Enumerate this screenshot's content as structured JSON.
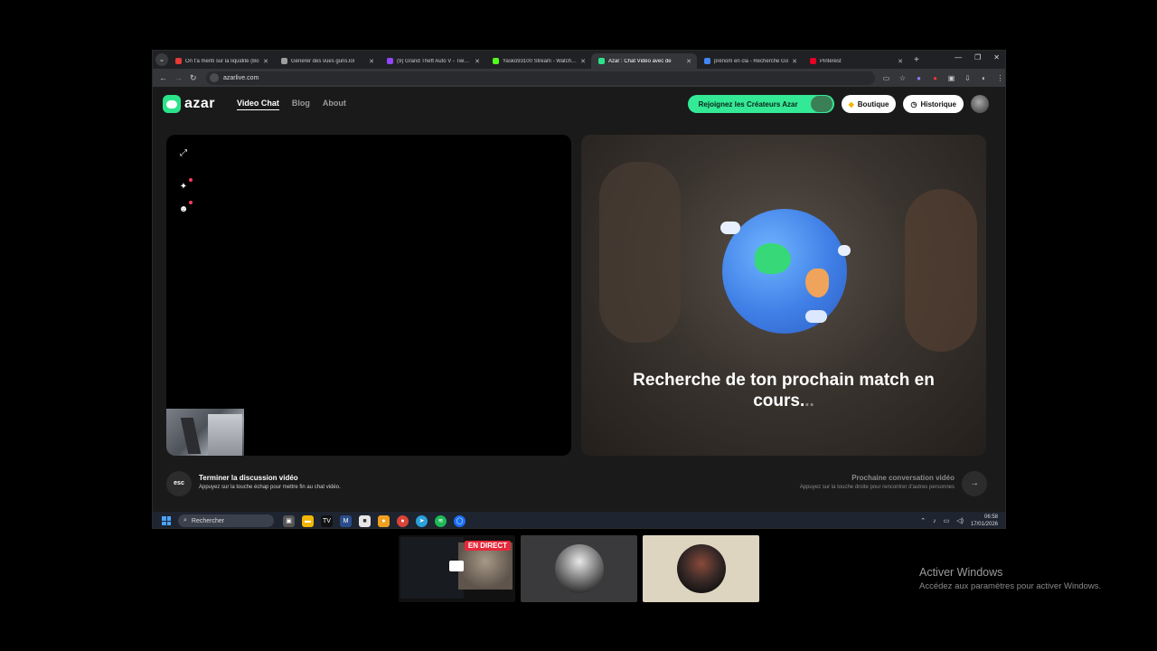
{
  "browser": {
    "tabs": [
      {
        "title": "On t'a menti sur la liquidité (Bo",
        "color": "#e53935"
      },
      {
        "title": "Générer des vues guns.lol",
        "color": "#9e9e9e"
      },
      {
        "title": "(9) Grand Theft Auto V - Twitch",
        "color": "#9146ff"
      },
      {
        "title": "Yasko93100 Stream - Watch Li",
        "color": "#53fc18"
      },
      {
        "title": "Azar : Chat Vidéo avec de",
        "color": "#2be38a"
      },
      {
        "title": "prénom en cla - Recherche Go",
        "color": "#4285f4"
      },
      {
        "title": "Pinterest",
        "color": "#e60023"
      }
    ],
    "active_tab": 4,
    "url": "azarlive.com"
  },
  "site": {
    "brand": "azar",
    "nav": {
      "video_chat": "Video Chat",
      "blog": "Blog",
      "about": "About"
    },
    "creators_button": "Rejoignez les Créateurs Azar",
    "shop_button": "Boutique",
    "history_button": "Historique",
    "searching_text": "Recherche de ton prochain match en cours.",
    "searching_dots": "..",
    "end_title": "Terminer la discussion vidéo",
    "end_subtitle": "Appuyez sur la touche échap pour mettre fin au chat vidéo.",
    "esc_label": "esc",
    "next_title": "Prochaine conversation vidéo",
    "next_subtitle": "Appuyez sur la touche droite pour rencontrer d'autres personnes"
  },
  "taskbar": {
    "search_placeholder": "Rechercher",
    "time": "06:58",
    "date": "17/01/2026"
  },
  "stream": {
    "live_badge": "EN DIRECT"
  },
  "windows_activation": {
    "title": "Activer Windows",
    "subtitle": "Accédez aux paramètres pour activer Windows."
  }
}
